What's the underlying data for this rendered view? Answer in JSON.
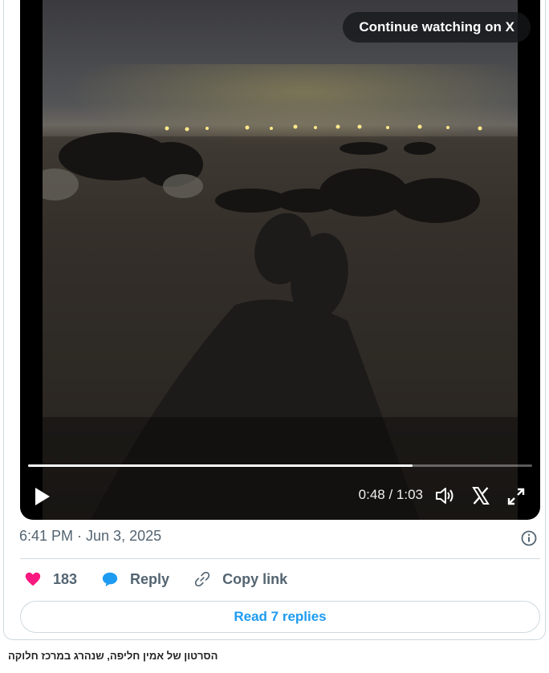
{
  "video": {
    "continue_label": "Continue watching on X",
    "progress": 0.762,
    "time": "0:48 / 1:03",
    "icons": [
      "play-icon",
      "volume-icon",
      "x-logo-icon",
      "fullscreen-icon"
    ]
  },
  "tweet": {
    "timestamp": "6:41 PM · Jun 3, 2025",
    "like_count": "183",
    "reply_label": "Reply",
    "copy_label": "Copy link",
    "replies_button": "Read 7 replies"
  },
  "caption": "הסרטון של אמין חליפה, שנהרג במרכז חלוקה",
  "colors": {
    "like": "#f91880",
    "reply": "#1d9bf0",
    "link": "#1d9bf0",
    "muted_text": "#536471",
    "border": "#cfd9de"
  }
}
